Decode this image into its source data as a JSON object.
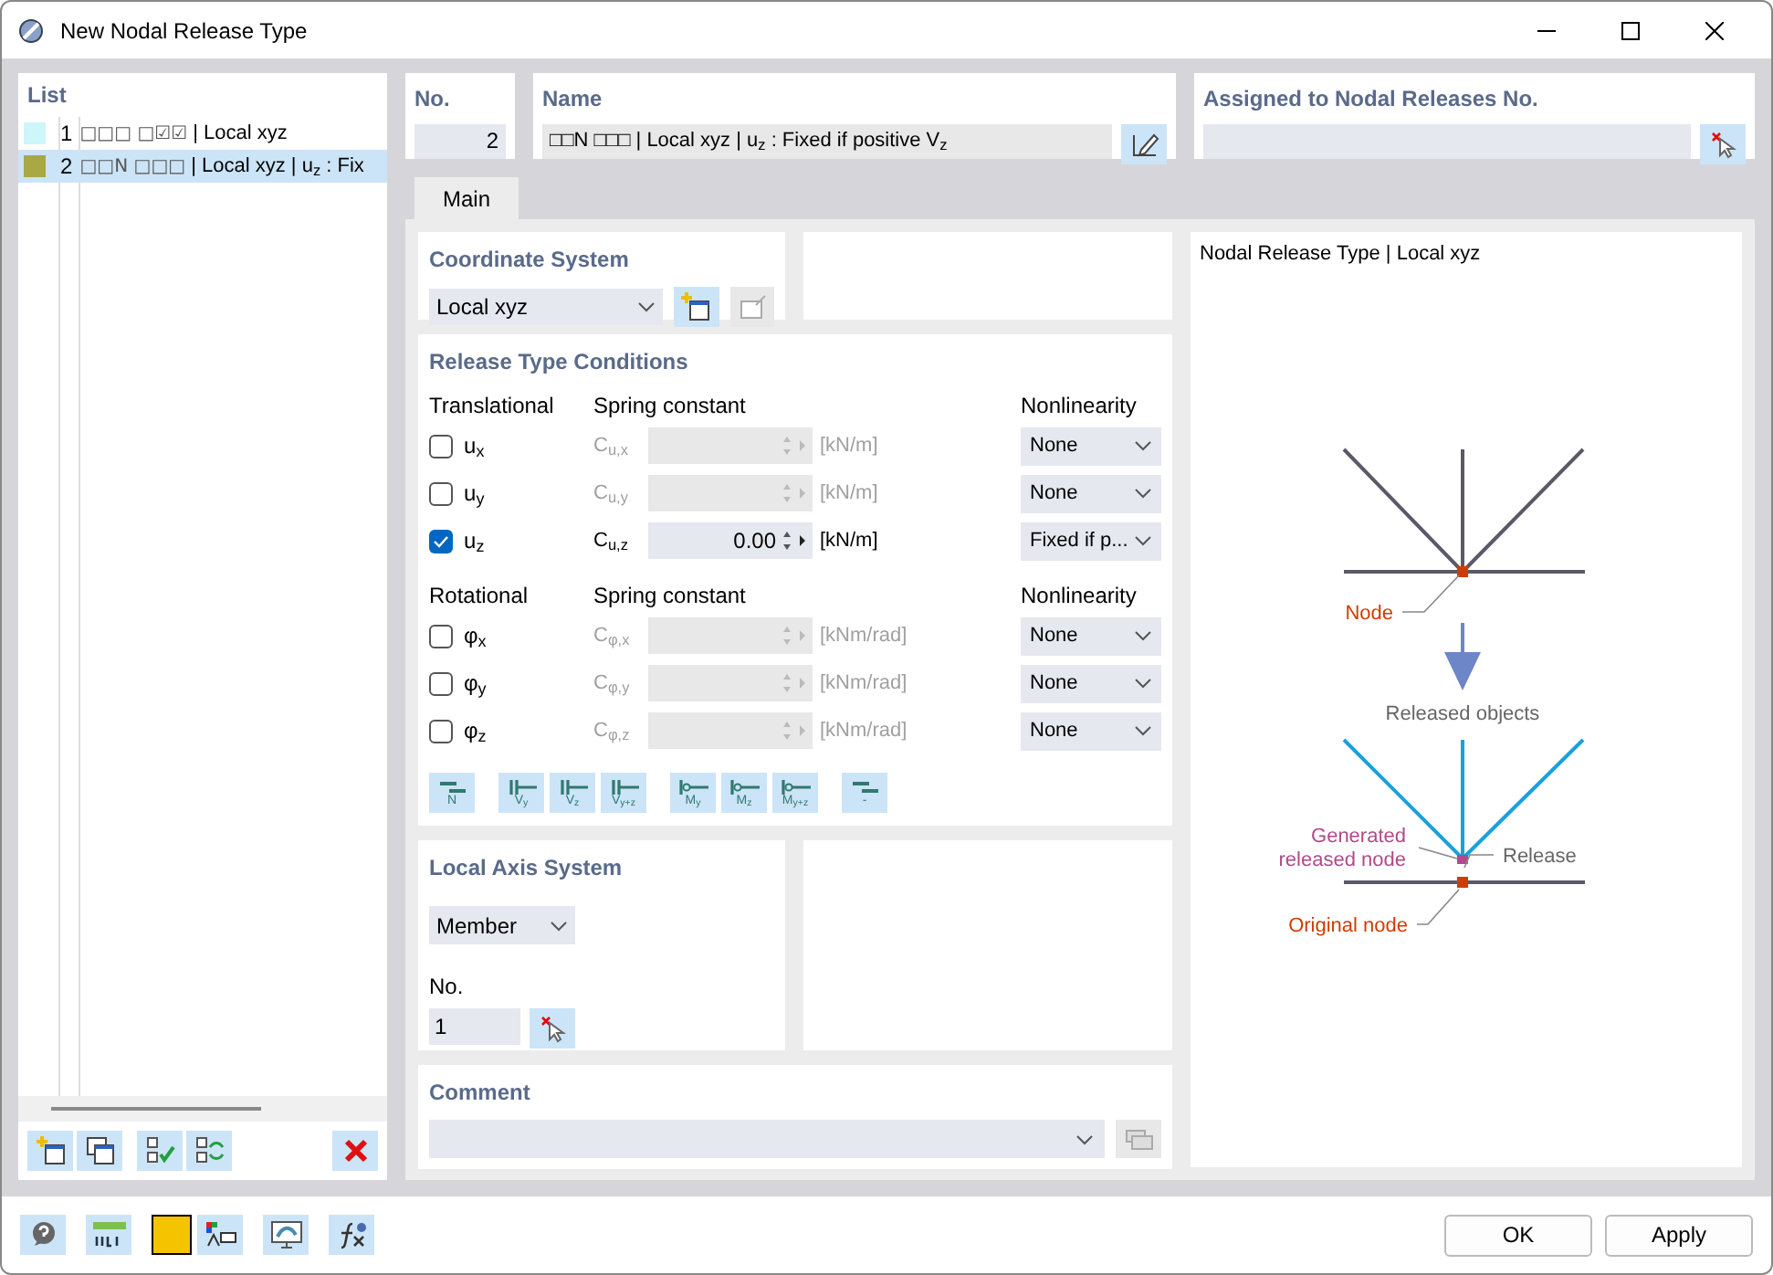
{
  "window": {
    "title": "New Nodal Release Type"
  },
  "list": {
    "title": "List",
    "items": [
      {
        "number": "1",
        "color": "#ccf6fa",
        "codes": "□□□ □☑☑",
        "label": "| Local xyz",
        "selected": false
      },
      {
        "number": "2",
        "color": "#a9a845",
        "codes": "□□N □□□",
        "label": "| Local xyz | u$_{z}$ : Fix",
        "selected": true
      }
    ]
  },
  "number": {
    "label": "No.",
    "value": "2"
  },
  "name": {
    "label": "Name",
    "value": "□□N □□□ | Local xyz | u$_{z}$ : Fixed if positive V$_{z}$"
  },
  "assigned": {
    "label": "Assigned to Nodal Releases No."
  },
  "tabs": [
    {
      "label": "Main",
      "selected": true
    }
  ],
  "coordinate_system": {
    "title": "Coordinate System",
    "value": "Local xyz"
  },
  "release_conditions": {
    "title": "Release Type Conditions",
    "groups": [
      {
        "heading": "Translational",
        "spring_heading": "Spring constant",
        "nonlinearity_heading": "Nonlinearity",
        "rows": [
          {
            "symbol": "u$_{x}$",
            "checked": false,
            "spring": "C$_{u,x}$",
            "unit": "[kN/m]",
            "nonlinearity": "None"
          },
          {
            "symbol": "u$_{y}$",
            "checked": false,
            "spring": "C$_{u,y}$",
            "unit": "[kN/m]",
            "nonlinearity": "None"
          },
          {
            "symbol": "u$_{z}$",
            "checked": true,
            "spring": "C$_{u,z}$",
            "value": "0.00",
            "unit": "[kN/m]",
            "nonlinearity": "Fixed if p..."
          }
        ]
      },
      {
        "heading": "Rotational",
        "spring_heading": "Spring constant",
        "nonlinearity_heading": "Nonlinearity",
        "rows": [
          {
            "symbol": "φ$_{x}$",
            "checked": false,
            "spring": "C$_{φ,x}$",
            "unit": "[kNm/rad]",
            "nonlinearity": "None"
          },
          {
            "symbol": "φ$_{y}$",
            "checked": false,
            "spring": "C$_{φ,y}$",
            "unit": "[kNm/rad]",
            "nonlinearity": "None"
          },
          {
            "symbol": "φ$_{z}$",
            "checked": false,
            "spring": "C$_{φ,z}$",
            "unit": "[kNm/rad]",
            "nonlinearity": "None"
          }
        ]
      }
    ],
    "buttons": [
      {
        "label": "N",
        "kind": "axial"
      },
      {
        "label": "V$_{y}$",
        "kind": "shear"
      },
      {
        "label": "V$_{z}$",
        "kind": "shear"
      },
      {
        "label": "V$_{y+z}$",
        "kind": "shear"
      },
      {
        "label": "M$_{y}$",
        "kind": "moment"
      },
      {
        "label": "M$_{z}$",
        "kind": "moment"
      },
      {
        "label": "M$_{y+z}$",
        "kind": "moment"
      },
      {
        "label": "-",
        "kind": "axial"
      }
    ]
  },
  "local_axis": {
    "title": "Local Axis System",
    "value": "Member",
    "number_label": "No.",
    "number": "1"
  },
  "comment": {
    "title": "Comment"
  },
  "diagram": {
    "title": "Nodal Release Type | Local xyz",
    "node": "Node",
    "released_objects": "Released objects",
    "generated": "Generated",
    "generated_2": "released node",
    "release": "Release",
    "original": "Original node"
  },
  "buttons": [
    {
      "label": "OK"
    },
    {
      "label": "Apply"
    }
  ]
}
